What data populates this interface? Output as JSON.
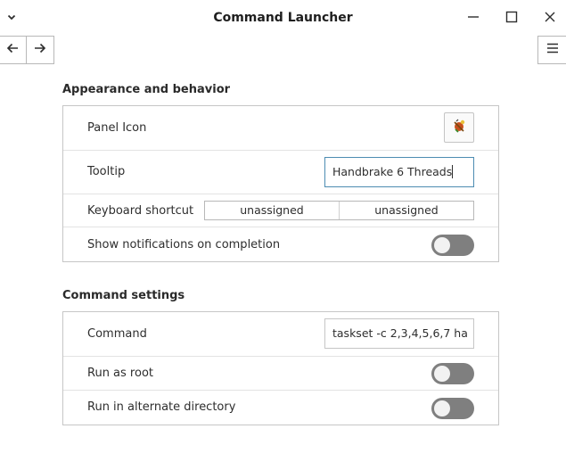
{
  "window": {
    "title": "Command Launcher",
    "menu_icon": "chevron-down-icon",
    "minimize_icon": "minimize-icon",
    "maximize_icon": "maximize-icon",
    "close_icon": "close-icon"
  },
  "navigation": {
    "back_icon": "arrow-left-icon",
    "forward_icon": "arrow-right-icon",
    "hamburger_icon": "hamburger-menu-icon"
  },
  "appearance": {
    "section_title": "Appearance and behavior",
    "panel_icon_label": "Panel Icon",
    "panel_icon_icon": "panel-launcher-icon",
    "tooltip_label": "Tooltip",
    "tooltip_value": "Handbrake 6 Threads",
    "shortcut_label": "Keyboard shortcut",
    "shortcut_primary": "unassigned",
    "shortcut_secondary": "unassigned",
    "notifications_label": "Show notifications on completion",
    "notifications_on": false
  },
  "command": {
    "section_title": "Command settings",
    "command_label": "Command",
    "command_value": "taskset -c 2,3,4,5,6,7 ha",
    "run_as_root_label": "Run as root",
    "run_as_root_on": false,
    "alt_dir_label": "Run in alternate directory",
    "alt_dir_on": false
  },
  "colors": {
    "focus_border": "#4d8cb2",
    "toggle_off": "#7f7f7f"
  }
}
